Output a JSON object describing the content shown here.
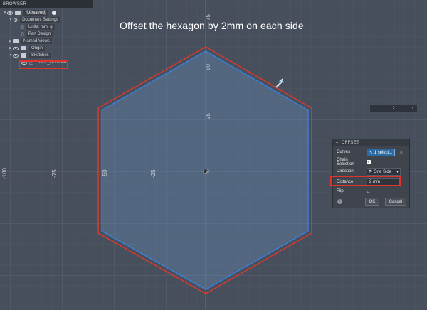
{
  "instruction": "Offset the hexagon by 2mm on each side",
  "axes": {
    "x_labels": [
      "-100",
      "-75",
      "-50",
      "-25"
    ],
    "y_labels": [
      "75",
      "50",
      "25"
    ]
  },
  "browser": {
    "title": "BROWSER",
    "root": "(Unsaved)",
    "document_settings": "Document Settings",
    "units": "Units: mm, g",
    "part_design": "Part Design",
    "named_views": "Named Views",
    "origin": "Origin",
    "sketches": "Sketches",
    "tile_outline": "TILE_OUTLINE"
  },
  "value_box": "2",
  "offset_dialog": {
    "title": "OFFSET",
    "curves_label": "Curves",
    "curves_value": "1 select...",
    "chain_label": "Chain Selection",
    "direction_label": "Direction",
    "direction_value": "One Side",
    "distance_label": "Distance",
    "distance_value": "2 mm",
    "flip_label": "Flip",
    "ok": "OK",
    "cancel": "Cancel"
  },
  "colors": {
    "hexagon_stroke": "#3b7fd6",
    "offset_stroke": "#d83a2f",
    "highlight": "#e1322c"
  }
}
